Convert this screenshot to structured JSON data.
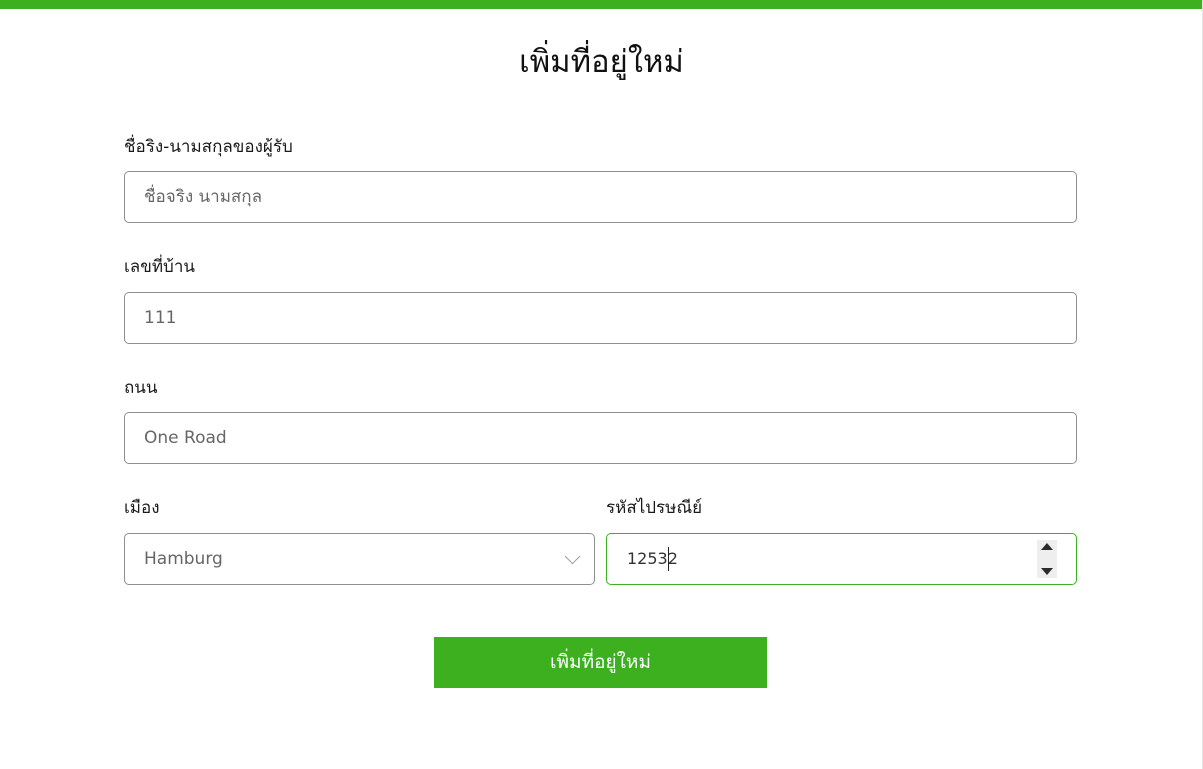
{
  "page": {
    "title": "เพิ่มที่อยู่ใหม่"
  },
  "form": {
    "recipient_name": {
      "label": "ชื่อริง-นามสกุลของผู้รับ",
      "placeholder": "ชื่อจริง นามสกุล",
      "value": ""
    },
    "house_number": {
      "label": "เลขที่บ้าน",
      "value": "111"
    },
    "street": {
      "label": "ถนน",
      "value": "One Road"
    },
    "city": {
      "label": "เมือง",
      "selected": "Hamburg"
    },
    "postal_code": {
      "label": "รหัสไปรษณีย์",
      "value": "12532"
    },
    "submit_label": "เพิ่มที่อยู่ใหม่"
  },
  "colors": {
    "accent": "#3cb01f",
    "field_border": "#8f8f8f",
    "focus_border": "#3cb01f"
  },
  "icons": {
    "city_dropdown": "chevron-down-icon",
    "postal_spinner_up": "spin-up-icon",
    "postal_spinner_down": "spin-down-icon"
  }
}
